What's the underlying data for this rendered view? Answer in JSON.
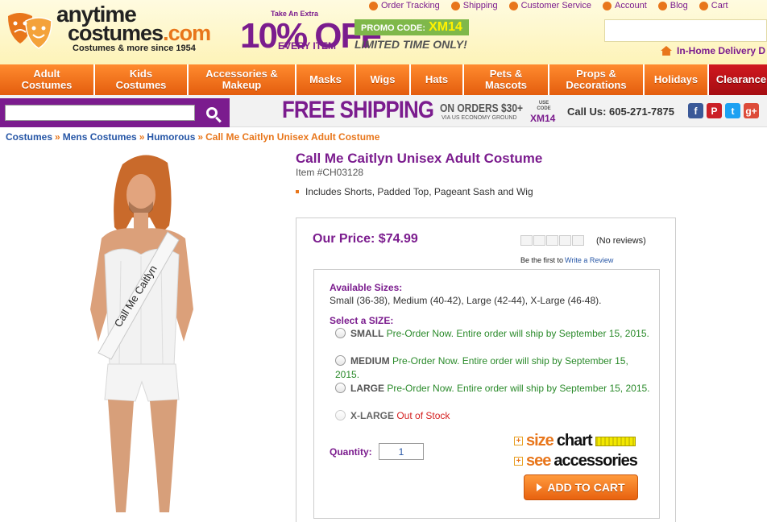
{
  "logo": {
    "line1": "anytime",
    "line2": "costumes",
    "tld": ".com",
    "tagline": "Costumes & more since 1954"
  },
  "promo": {
    "take": "Take An Extra",
    "percent": "10% OFF",
    "every": "EVERY ITEM",
    "code_label": "PROMO CODE:",
    "code": "XM14",
    "limited": "LIMITED TIME ONLY!"
  },
  "toplinks": [
    "Order Tracking",
    "Shipping",
    "Customer Service",
    "Account",
    "Blog",
    "Cart"
  ],
  "inhome": "In-Home Delivery D",
  "nav": [
    {
      "label": "Adult Costumes",
      "w": 118
    },
    {
      "label": "Kids Costumes",
      "w": 116
    },
    {
      "label": "Accessories & Makeup",
      "w": 134
    },
    {
      "label": "Masks",
      "w": 74
    },
    {
      "label": "Wigs",
      "w": 68
    },
    {
      "label": "Hats",
      "w": 66
    },
    {
      "label": "Pets & Mascots",
      "w": 106
    },
    {
      "label": "Props & Decorations",
      "w": 118
    },
    {
      "label": "Holidays",
      "w": 80
    },
    {
      "label": "Clearance",
      "w": 80
    }
  ],
  "bar": {
    "search_placeholder": "",
    "free_shipping": "FREE SHIPPING",
    "on_orders": "ON ORDERS $30+",
    "via": "VIA US ECONOMY GROUND",
    "use_code": "USE CODE",
    "use_code_value": "XM14",
    "call_us": "Call Us: 605-271-7875",
    "socials": [
      {
        "name": "facebook-icon",
        "glyph": "f",
        "color": "#3b5998"
      },
      {
        "name": "pinterest-icon",
        "glyph": "P",
        "color": "#cb2027"
      },
      {
        "name": "twitter-icon",
        "glyph": "t",
        "color": "#1da1f2"
      },
      {
        "name": "googleplus-icon",
        "glyph": "g+",
        "color": "#dd4b39"
      }
    ]
  },
  "breadcrumb": [
    "Costumes",
    "Mens Costumes",
    "Humorous",
    "Call Me Caitlyn Unisex Adult Costume"
  ],
  "product": {
    "title": "Call Me Caitlyn Unisex Adult Costume",
    "item": "Item #CH03128",
    "feature": "Includes Shorts, Padded Top, Pageant Sash and Wig",
    "price": "Our Price: $74.99",
    "reviews": "(No reviews)",
    "be_first": "Be the first to",
    "write_review": "Write a Review",
    "sash_text": "Call Me Caitlyn",
    "available_label": "Available Sizes:",
    "available_text": "Small (36-38), Medium (40-42), Large (42-44), X-Large (46-48).",
    "select_label": "Select a SIZE:",
    "sizes": [
      {
        "name": "SMALL",
        "status": "Pre-Order Now. Entire order will ship by September 15, 2015.",
        "available": true
      },
      {
        "name": "MEDIUM",
        "status": "Pre-Order Now. Entire order will ship by September 15, 2015.",
        "available": true
      },
      {
        "name": "LARGE",
        "status": "Pre-Order Now. Entire order will ship by September 15, 2015.",
        "available": true
      },
      {
        "name": "X-LARGE",
        "status": "Out of Stock",
        "available": false
      }
    ],
    "quantity_label": "Quantity:",
    "quantity": "1",
    "size_chart_a": "size",
    "size_chart_b": "chart",
    "see_acc_a": "see",
    "see_acc_b": "accessories",
    "add_to_cart": "ADD TO CART"
  },
  "colors": {
    "purple": "#7b1c8e",
    "orange": "#e8761b",
    "nav": "#f26b1d",
    "clearance": "#c0141a",
    "green": "#2a8a2a",
    "red": "#d42020"
  }
}
